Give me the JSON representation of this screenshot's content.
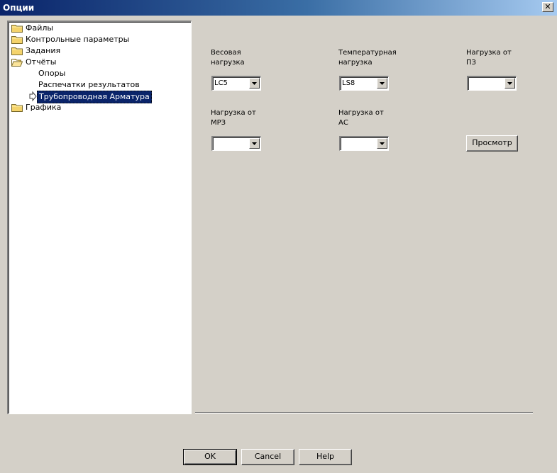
{
  "window": {
    "title": "Опции",
    "close_symbol": "✕"
  },
  "tree": {
    "items": [
      {
        "label": "Файлы",
        "icon": "folder-icon"
      },
      {
        "label": "Контрольные параметры",
        "icon": "folder-icon"
      },
      {
        "label": "Задания",
        "icon": "folder-icon"
      },
      {
        "label": "Отчёты",
        "icon": "open-folder-icon",
        "children": [
          {
            "label": "Опоры"
          },
          {
            "label": "Распечатки результатов"
          },
          {
            "label": "Трубопроводная Арматура",
            "selected": true
          }
        ]
      },
      {
        "label": "Графика",
        "icon": "folder-icon"
      }
    ]
  },
  "panel": {
    "fields": {
      "weight": {
        "label_line1": "Весовая",
        "label_line2": "нагрузка",
        "value": "LC5"
      },
      "temperature": {
        "label_line1": "Температурная",
        "label_line2": "нагрузка",
        "value": "LS8"
      },
      "pz": {
        "label_line1": "Нагрузка от",
        "label_line2": "ПЗ",
        "value": ""
      },
      "mrz": {
        "label_line1": "Нагрузка от",
        "label_line2": "МРЗ",
        "value": ""
      },
      "as": {
        "label_line1": "Нагрузка от",
        "label_line2": "АС",
        "value": ""
      }
    },
    "preview_label": "Просмотр"
  },
  "buttons": {
    "ok": "OK",
    "cancel": "Cancel",
    "help": "Help"
  },
  "colors": {
    "selection": "#0a246a",
    "face": "#d4d0c8",
    "folder": "#f4d36b"
  }
}
